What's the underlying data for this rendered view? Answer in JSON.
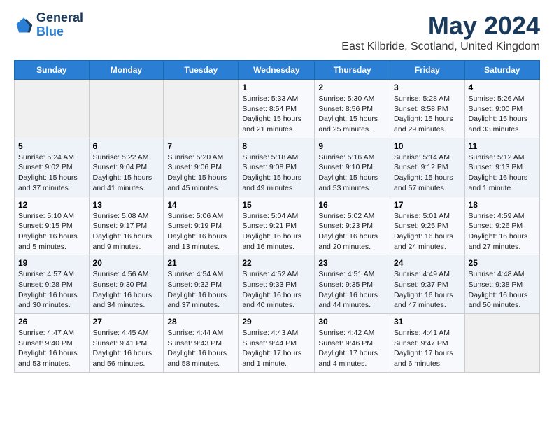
{
  "logo": {
    "line1": "General",
    "line2": "Blue"
  },
  "title": "May 2024",
  "location": "East Kilbride, Scotland, United Kingdom",
  "days_header": [
    "Sunday",
    "Monday",
    "Tuesday",
    "Wednesday",
    "Thursday",
    "Friday",
    "Saturday"
  ],
  "weeks": [
    [
      {
        "num": "",
        "info": ""
      },
      {
        "num": "",
        "info": ""
      },
      {
        "num": "",
        "info": ""
      },
      {
        "num": "1",
        "info": "Sunrise: 5:33 AM\nSunset: 8:54 PM\nDaylight: 15 hours\nand 21 minutes."
      },
      {
        "num": "2",
        "info": "Sunrise: 5:30 AM\nSunset: 8:56 PM\nDaylight: 15 hours\nand 25 minutes."
      },
      {
        "num": "3",
        "info": "Sunrise: 5:28 AM\nSunset: 8:58 PM\nDaylight: 15 hours\nand 29 minutes."
      },
      {
        "num": "4",
        "info": "Sunrise: 5:26 AM\nSunset: 9:00 PM\nDaylight: 15 hours\nand 33 minutes."
      }
    ],
    [
      {
        "num": "5",
        "info": "Sunrise: 5:24 AM\nSunset: 9:02 PM\nDaylight: 15 hours\nand 37 minutes."
      },
      {
        "num": "6",
        "info": "Sunrise: 5:22 AM\nSunset: 9:04 PM\nDaylight: 15 hours\nand 41 minutes."
      },
      {
        "num": "7",
        "info": "Sunrise: 5:20 AM\nSunset: 9:06 PM\nDaylight: 15 hours\nand 45 minutes."
      },
      {
        "num": "8",
        "info": "Sunrise: 5:18 AM\nSunset: 9:08 PM\nDaylight: 15 hours\nand 49 minutes."
      },
      {
        "num": "9",
        "info": "Sunrise: 5:16 AM\nSunset: 9:10 PM\nDaylight: 15 hours\nand 53 minutes."
      },
      {
        "num": "10",
        "info": "Sunrise: 5:14 AM\nSunset: 9:12 PM\nDaylight: 15 hours\nand 57 minutes."
      },
      {
        "num": "11",
        "info": "Sunrise: 5:12 AM\nSunset: 9:13 PM\nDaylight: 16 hours\nand 1 minute."
      }
    ],
    [
      {
        "num": "12",
        "info": "Sunrise: 5:10 AM\nSunset: 9:15 PM\nDaylight: 16 hours\nand 5 minutes."
      },
      {
        "num": "13",
        "info": "Sunrise: 5:08 AM\nSunset: 9:17 PM\nDaylight: 16 hours\nand 9 minutes."
      },
      {
        "num": "14",
        "info": "Sunrise: 5:06 AM\nSunset: 9:19 PM\nDaylight: 16 hours\nand 13 minutes."
      },
      {
        "num": "15",
        "info": "Sunrise: 5:04 AM\nSunset: 9:21 PM\nDaylight: 16 hours\nand 16 minutes."
      },
      {
        "num": "16",
        "info": "Sunrise: 5:02 AM\nSunset: 9:23 PM\nDaylight: 16 hours\nand 20 minutes."
      },
      {
        "num": "17",
        "info": "Sunrise: 5:01 AM\nSunset: 9:25 PM\nDaylight: 16 hours\nand 24 minutes."
      },
      {
        "num": "18",
        "info": "Sunrise: 4:59 AM\nSunset: 9:26 PM\nDaylight: 16 hours\nand 27 minutes."
      }
    ],
    [
      {
        "num": "19",
        "info": "Sunrise: 4:57 AM\nSunset: 9:28 PM\nDaylight: 16 hours\nand 30 minutes."
      },
      {
        "num": "20",
        "info": "Sunrise: 4:56 AM\nSunset: 9:30 PM\nDaylight: 16 hours\nand 34 minutes."
      },
      {
        "num": "21",
        "info": "Sunrise: 4:54 AM\nSunset: 9:32 PM\nDaylight: 16 hours\nand 37 minutes."
      },
      {
        "num": "22",
        "info": "Sunrise: 4:52 AM\nSunset: 9:33 PM\nDaylight: 16 hours\nand 40 minutes."
      },
      {
        "num": "23",
        "info": "Sunrise: 4:51 AM\nSunset: 9:35 PM\nDaylight: 16 hours\nand 44 minutes."
      },
      {
        "num": "24",
        "info": "Sunrise: 4:49 AM\nSunset: 9:37 PM\nDaylight: 16 hours\nand 47 minutes."
      },
      {
        "num": "25",
        "info": "Sunrise: 4:48 AM\nSunset: 9:38 PM\nDaylight: 16 hours\nand 50 minutes."
      }
    ],
    [
      {
        "num": "26",
        "info": "Sunrise: 4:47 AM\nSunset: 9:40 PM\nDaylight: 16 hours\nand 53 minutes."
      },
      {
        "num": "27",
        "info": "Sunrise: 4:45 AM\nSunset: 9:41 PM\nDaylight: 16 hours\nand 56 minutes."
      },
      {
        "num": "28",
        "info": "Sunrise: 4:44 AM\nSunset: 9:43 PM\nDaylight: 16 hours\nand 58 minutes."
      },
      {
        "num": "29",
        "info": "Sunrise: 4:43 AM\nSunset: 9:44 PM\nDaylight: 17 hours\nand 1 minute."
      },
      {
        "num": "30",
        "info": "Sunrise: 4:42 AM\nSunset: 9:46 PM\nDaylight: 17 hours\nand 4 minutes."
      },
      {
        "num": "31",
        "info": "Sunrise: 4:41 AM\nSunset: 9:47 PM\nDaylight: 17 hours\nand 6 minutes."
      },
      {
        "num": "",
        "info": ""
      }
    ]
  ]
}
